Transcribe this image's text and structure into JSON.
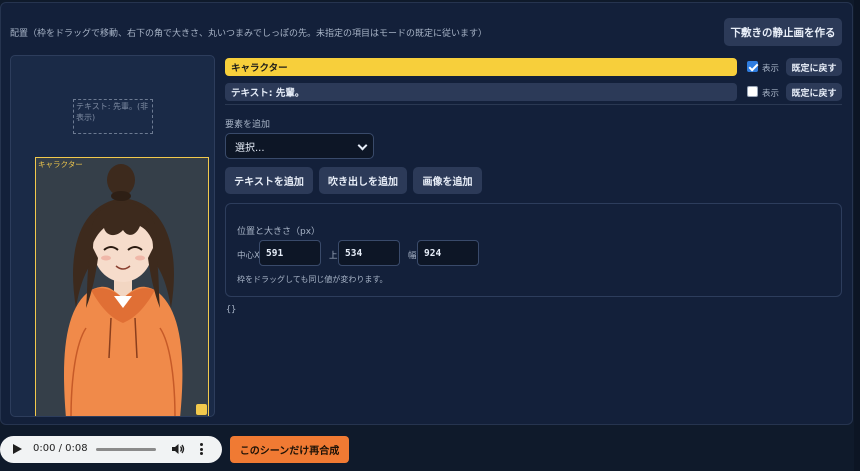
{
  "header": {
    "hint": "配置（枠をドラッグで移動、右下の角で大きさ、丸いつまみでしっぽの先。未指定の項目はモードの既定に従います）",
    "make_still_button": "下敷きの静止画を作る"
  },
  "preview": {
    "text_box_label": "テキスト: 先輩。(非表示)",
    "character_label": "キャラクター"
  },
  "layers": [
    {
      "name": "キャラクター",
      "checked": true,
      "show_label": "表示",
      "reset_label": "既定に戻す",
      "color": "#f7cf3b"
    },
    {
      "name": "テキスト: 先輩。",
      "checked": false,
      "show_label": "表示",
      "reset_label": "既定に戻す"
    }
  ],
  "add_element": {
    "label": "要素を追加",
    "select_value": "選択...",
    "add_text_button": "テキストを追加",
    "add_bubble_button": "吹き出しを追加",
    "add_image_button": "画像を追加"
  },
  "position": {
    "title": "位置と大きさ（px）",
    "center_x_label": "中心X",
    "center_x_value": "591",
    "top_label": "上",
    "top_value": "534",
    "width_label": "幅",
    "width_value": "924",
    "note": "枠をドラッグしても同じ値が変わります。"
  },
  "json_text": "{}",
  "audio": {
    "time": "0:00 / 0:08",
    "progress": 0
  },
  "recompose_button": "このシーンだけ再合成",
  "colors": {
    "accent_yellow": "#f7cf3b",
    "accent_orange": "#f07a33",
    "panel_bg": "#13203a",
    "button_bg": "#2c3a58"
  }
}
